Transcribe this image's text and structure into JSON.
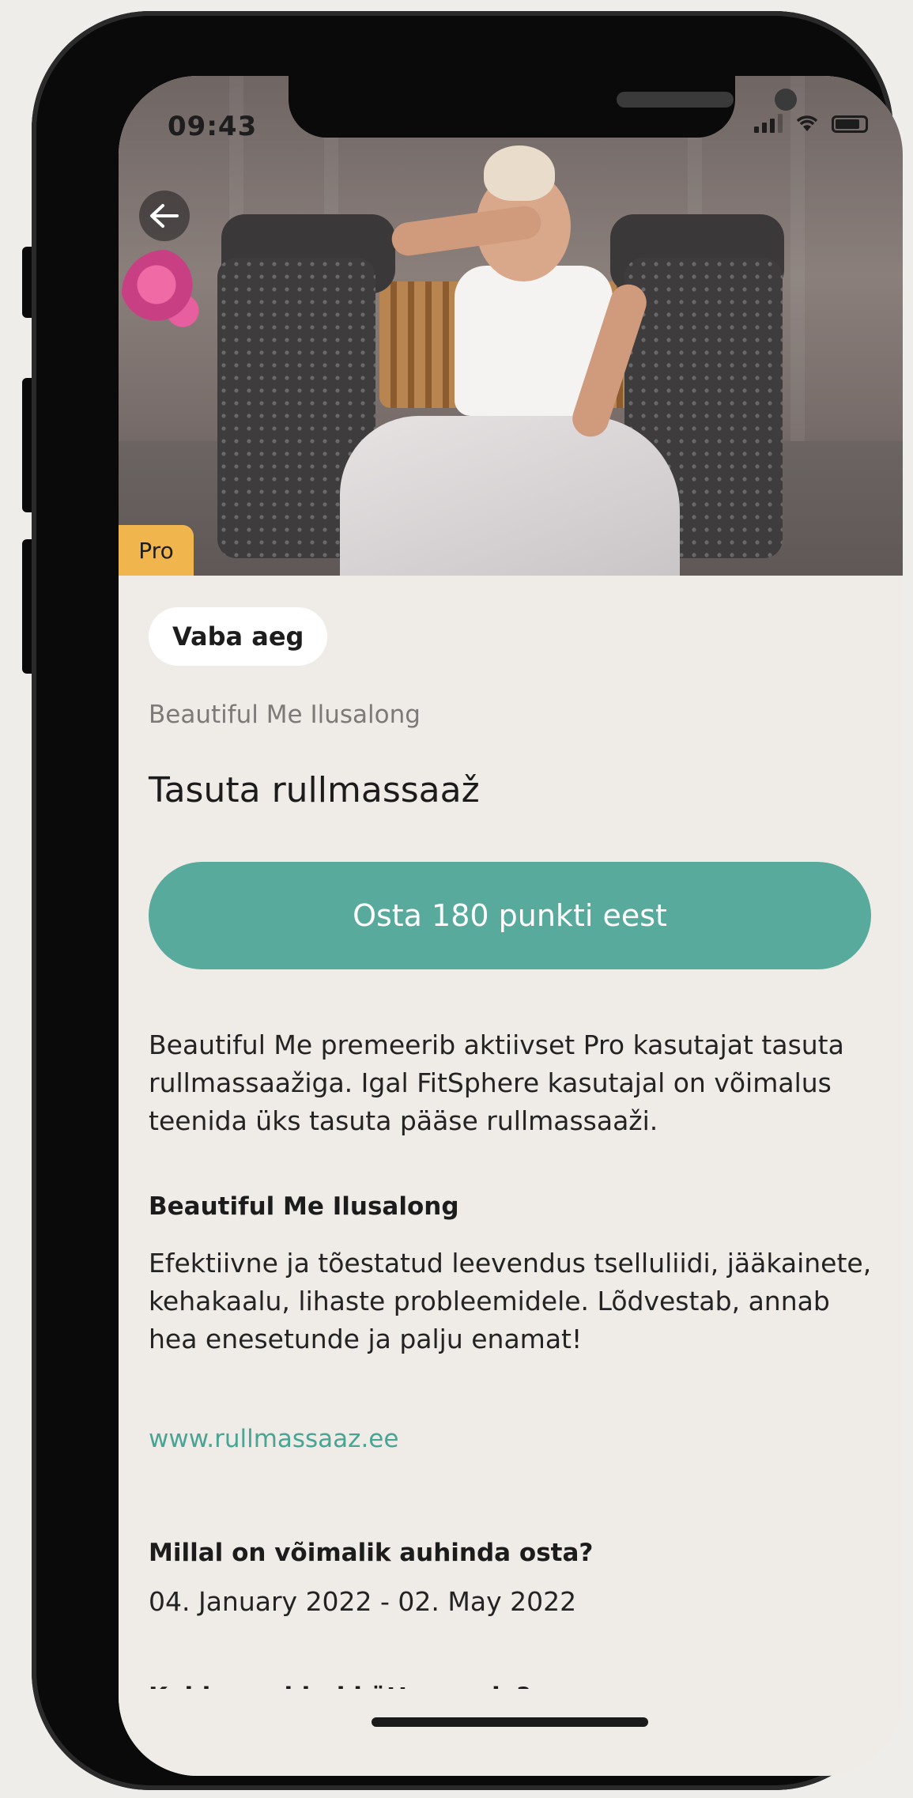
{
  "status_bar": {
    "time": "09:43"
  },
  "hero": {
    "badge": "Pro"
  },
  "reward": {
    "category": "Vaba aeg",
    "partner_name": "Beautiful Me Ilusalong",
    "title": "Tasuta rullmassaaž",
    "buy_button": "Osta 180 punkti eest",
    "description": "Beautiful Me premeerib aktiivset Pro kasutajat tasuta rullmassaažiga. Igal FitSphere kasutajal on võimalus teenida üks tasuta pääse rullmassaaži."
  },
  "partner_section": {
    "heading": "Beautiful Me Ilusalong",
    "description": "Efektiivne ja tõestatud leevendus tselluliidi, jääkainete, kehakaalu, lihaste probleemidele. Lõdvestab, annab hea enesetunde ja palju enamat!",
    "link": "www.rullmassaaz.ee"
  },
  "availability": {
    "heading": "Millal on võimalik auhinda osta?",
    "dates": "04. January 2022 - 02. May 2022"
  },
  "redeem": {
    "heading": "Kuidas auhind kätte saada?"
  },
  "colors": {
    "accent": "#57aa9c",
    "badge": "#f1b54d",
    "background": "#efebe7"
  },
  "icons": {
    "back": "arrow-left-icon",
    "signal": "signal-icon",
    "wifi": "wifi-icon",
    "battery": "battery-icon"
  }
}
